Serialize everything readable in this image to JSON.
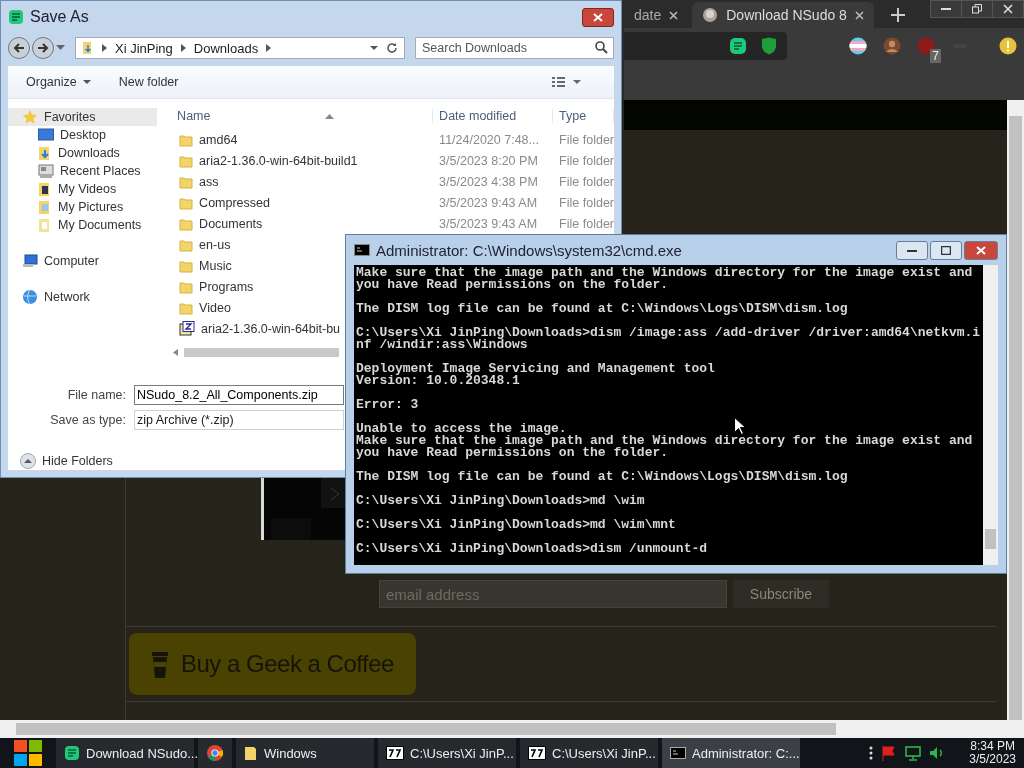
{
  "browser": {
    "tabs": [
      {
        "title": "date",
        "selected": false
      },
      {
        "title": "Download NSudo 8",
        "selected": true
      }
    ],
    "extension_badge": "7",
    "page": {
      "email_field": {
        "placeholder": "email address"
      },
      "subscribe_button": "Subscribe",
      "coffee_button": "Buy a Geek a Coffee"
    }
  },
  "save_dialog": {
    "title": "Save As",
    "breadcrumb": [
      "Xi JinPing",
      "Downloads"
    ],
    "search": {
      "placeholder": "Search Downloads"
    },
    "toolbar": [
      "Organize",
      "New folder"
    ],
    "nav": [
      {
        "label": "Favorites",
        "kind": "favorites",
        "selected": true,
        "children": [
          {
            "label": "Desktop",
            "kind": "desktop",
            "selected": false
          },
          {
            "label": "Downloads",
            "kind": "downloads",
            "selected": false
          },
          {
            "label": "Recent Places",
            "kind": "recent",
            "selected": false
          },
          {
            "label": "My Videos",
            "kind": "videos",
            "selected": false
          },
          {
            "label": "My Pictures",
            "kind": "pictures",
            "selected": false
          },
          {
            "label": "My Documents",
            "kind": "documents",
            "selected": false
          }
        ]
      },
      {
        "label": "Computer",
        "kind": "computer",
        "selected": false
      },
      {
        "label": "Network",
        "kind": "network",
        "selected": false
      }
    ],
    "columns": [
      "Name",
      "Date modified",
      "Type"
    ],
    "rows": [
      {
        "kind": "folder",
        "name": "amd64",
        "date": "11/24/2020 7:48...",
        "type": "File folder"
      },
      {
        "kind": "folder",
        "name": "aria2-1.36.0-win-64bit-build1",
        "date": "3/5/2023 8:20 PM",
        "type": "File folder"
      },
      {
        "kind": "folder",
        "name": "ass",
        "date": "3/5/2023 4:38 PM",
        "type": "File folder"
      },
      {
        "kind": "folder",
        "name": "Compressed",
        "date": "3/5/2023 9:43 AM",
        "type": "File folder"
      },
      {
        "kind": "folder",
        "name": "Documents",
        "date": "3/5/2023 9:43 AM",
        "type": "File folder"
      },
      {
        "kind": "folder",
        "name": "en-us"
      },
      {
        "kind": "folder",
        "name": "Music"
      },
      {
        "kind": "folder",
        "name": "Programs"
      },
      {
        "kind": "folder",
        "name": "Video"
      },
      {
        "kind": "archive",
        "name": "aria2-1.36.0-win-64bit-bu"
      }
    ],
    "file_name": {
      "label": "File name:",
      "value": "NSudo_8.2_All_Components.zip"
    },
    "save_type": {
      "label": "Save as type:",
      "value": "zip Archive (*.zip)"
    },
    "hide_folders": "Hide Folders"
  },
  "cmd": {
    "title": "Administrator: C:\\Windows\\system32\\cmd.exe",
    "blocks": [
      {
        "kind": "output",
        "lines": [
          "Make sure that the image path and the Windows directory for the image exist and",
          "you have Read permissions on the folder."
        ]
      },
      {
        "kind": "output",
        "lines": [
          "The DISM log file can be found at C:\\Windows\\Logs\\DISM\\dism.log"
        ]
      },
      {
        "kind": "output",
        "lines": [
          "C:\\Users\\Xi JinPing\\Downloads>dism /image:ass /add-driver /driver:amd64\\netkvm.i",
          "nf /windir:ass\\Windows"
        ]
      },
      {
        "kind": "output",
        "lines": [
          "Deployment Image Servicing and Management tool",
          "Version: 10.0.20348.1"
        ]
      },
      {
        "kind": "error",
        "lines": [
          "Error: 3"
        ]
      },
      {
        "kind": "output",
        "lines": [
          "Unable to access the image.",
          "Make sure that the image path and the Windows directory for the image exist and",
          "you have Read permissions on the folder."
        ]
      },
      {
        "kind": "output",
        "lines": [
          "The DISM log file can be found at C:\\Windows\\Logs\\DISM\\dism.log"
        ]
      },
      {
        "kind": "output",
        "lines": [
          "C:\\Users\\Xi JinPing\\Downloads>md \\wim"
        ]
      },
      {
        "kind": "output",
        "lines": [
          "C:\\Users\\Xi JinPing\\Downloads>md \\wim\\mnt"
        ]
      },
      {
        "kind": "output",
        "lines": [
          "C:\\Users\\Xi JinPing\\Downloads>dism /unmount-d"
        ]
      }
    ]
  },
  "taskbar": {
    "items": [
      {
        "kind": "notes",
        "label": "Download NSudo...",
        "selected": false
      },
      {
        "kind": "browser",
        "selected": false
      },
      {
        "kind": "folder",
        "label": "Windows",
        "selected": false
      },
      {
        "kind": "archiver",
        "label": "C:\\Users\\Xi JinP...",
        "selected": false
      },
      {
        "kind": "archiver",
        "label": "C:\\Users\\Xi JinP...",
        "selected": false
      },
      {
        "kind": "console",
        "label": "Administrator: C:...",
        "selected": true
      }
    ],
    "time": "8:34 PM",
    "date": "3/5/2023"
  }
}
